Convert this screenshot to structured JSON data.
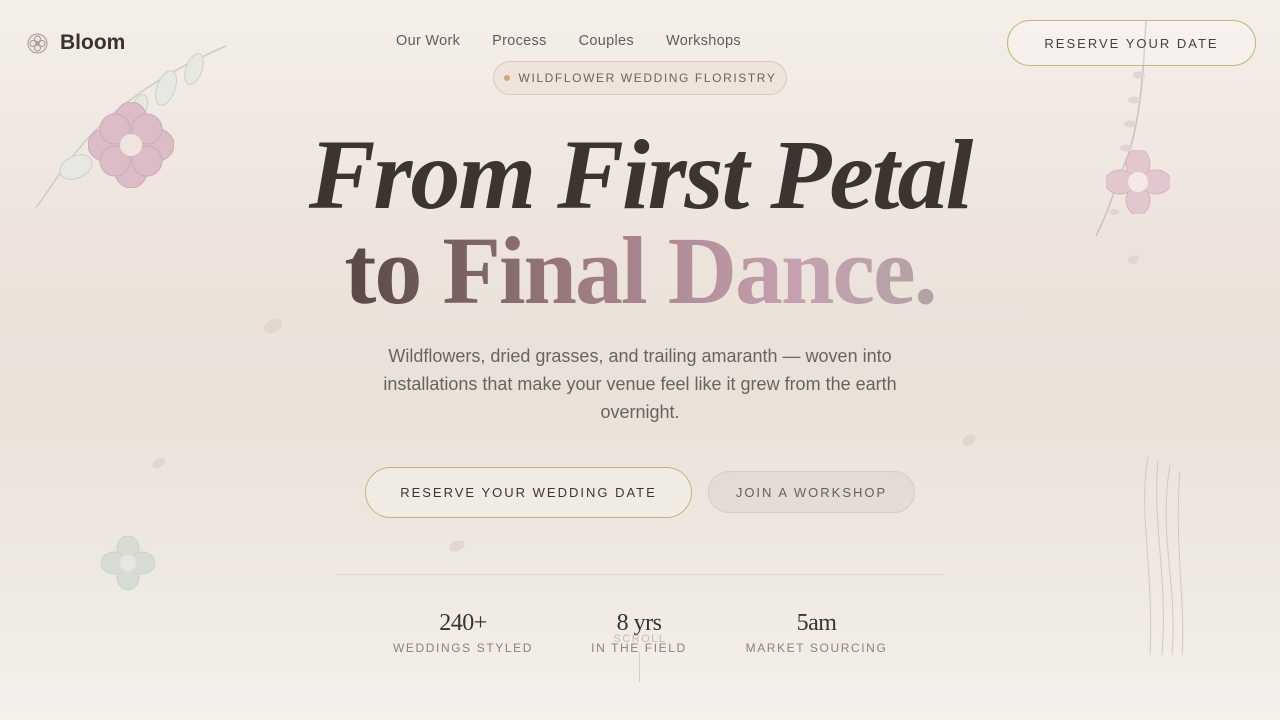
{
  "brand": {
    "name": "Bloom",
    "logo_icon": "flower-logo-icon"
  },
  "nav": {
    "items": [
      {
        "label": "Our Work"
      },
      {
        "label": "Process"
      },
      {
        "label": "Couples"
      },
      {
        "label": "Workshops"
      }
    ]
  },
  "header": {
    "cta_label": "Reserve your date"
  },
  "hero": {
    "badge": "Wildflower wedding floristry",
    "headline_line1": "From First Petal",
    "headline_line2_words": [
      "to",
      "Final",
      "Dance."
    ],
    "subtitle": "Wildflowers, dried grasses, and trailing amaranth — woven into installations that make your venue feel like it grew from the earth overnight.",
    "primary_cta": "Reserve your wedding date",
    "secondary_cta": "Join a workshop"
  },
  "stats": [
    {
      "value": "240+",
      "label": "Weddings styled"
    },
    {
      "value": "8 yrs",
      "label": "In the field"
    },
    {
      "value": "5am",
      "label": "Market sourcing"
    }
  ],
  "scroll": {
    "label": "Scroll"
  },
  "colors": {
    "accent_gold": "#cdb27e",
    "text_dark": "#3d3330",
    "petal_pink": "#c6a1b0"
  }
}
